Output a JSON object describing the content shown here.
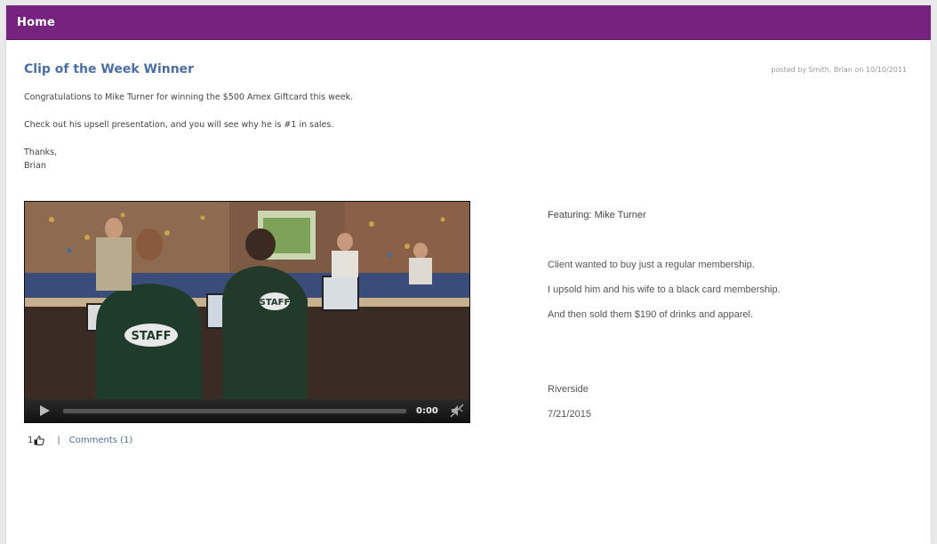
{
  "window": {
    "title": "Home",
    "accent_color": "#76237f"
  },
  "post": {
    "title": "Clip of the Week Winner",
    "posted_by": "posted by Smith, Brian on 10/10/2011",
    "paragraph_1": "Congratulations to Mike Turner for winning the $500 Amex Giftcard this week.",
    "paragraph_2": "Check out his upsell presentation, and you will see why he is #1 in sales.",
    "signoff_1": "Thanks,",
    "signoff_2": "Brian"
  },
  "video": {
    "time": "0:00",
    "play_icon": "play-icon",
    "mute_icon": "mute-icon",
    "progress": 0
  },
  "engagement": {
    "like_count": "1",
    "like_icon": "thumbs-up-icon",
    "separator": "|",
    "comments_label": "Comments (1)"
  },
  "details": {
    "featuring": "Featuring: Mike Turner",
    "line_1": "Client wanted to buy just a regular membership.",
    "line_2": "I upsold him and his wife to a black card membership.",
    "line_3": "And then sold them $190 of drinks and apparel.",
    "location": "Riverside",
    "date": "7/21/2015"
  }
}
